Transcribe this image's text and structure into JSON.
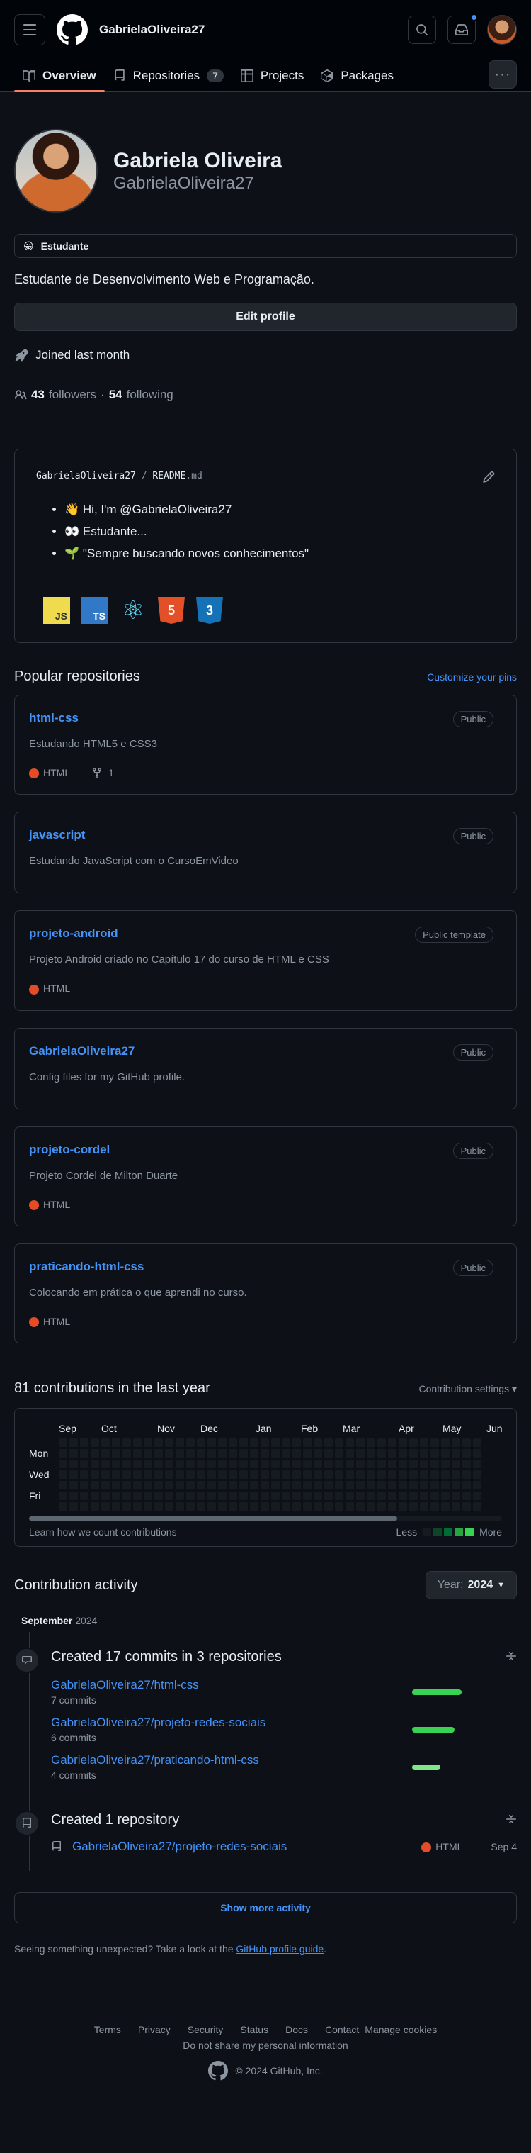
{
  "header": {
    "username": "GabrielaOliveira27"
  },
  "tabs": [
    {
      "label": "Overview"
    },
    {
      "label": "Repositories",
      "count": "7"
    },
    {
      "label": "Projects"
    },
    {
      "label": "Packages"
    }
  ],
  "more_label": "···",
  "profile": {
    "name": "Gabriela Oliveira",
    "login": "GabrielaOliveira27",
    "status_emoji": "😀",
    "status": "Estudante",
    "bio": "Estudante de Desenvolvimento Web e Programação.",
    "edit_label": "Edit profile",
    "joined": "Joined last month",
    "followers": "43",
    "followers_label": "followers",
    "sep": "·",
    "following": "54",
    "following_label": "following"
  },
  "readme": {
    "path_user": "GabrielaOliveira27",
    "path_sep": "/",
    "path_file": "README",
    "path_ext": ".md",
    "items": [
      "👋 Hi, I'm @GabrielaOliveira27",
      "👀 Estudante...",
      "🌱 \"Sempre buscando novos conhecimentos\""
    ],
    "tech": [
      "JS",
      "TS",
      "⚛",
      "5",
      "3"
    ]
  },
  "popular": {
    "title": "Popular repositories",
    "customize": "Customize your pins",
    "repos": [
      {
        "name": "html-css",
        "visibility": "Public",
        "desc": "Estudando HTML5 e CSS3",
        "lang": "HTML",
        "forks": "1"
      },
      {
        "name": "javascript",
        "visibility": "Public",
        "desc": "Estudando JavaScript com o CursoEmVideo",
        "lang": "",
        "forks": ""
      },
      {
        "name": "projeto-android",
        "visibility": "Public template",
        "desc": "Projeto Android criado no Capítulo 17 do curso de HTML e CSS",
        "lang": "HTML",
        "forks": ""
      },
      {
        "name": "GabrielaOliveira27",
        "visibility": "Public",
        "desc": "Config files for my GitHub profile.",
        "lang": "",
        "forks": ""
      },
      {
        "name": "projeto-cordel",
        "visibility": "Public",
        "desc": "Projeto Cordel de Milton Duarte",
        "lang": "HTML",
        "forks": ""
      },
      {
        "name": "praticando-html-css",
        "visibility": "Public",
        "desc": "Colocando em prática o que aprendi no curso.",
        "lang": "HTML",
        "forks": ""
      }
    ]
  },
  "contributions": {
    "title": "81 contributions in the last year",
    "settings": "Contribution settings ▾",
    "months": [
      "Sep",
      "Oct",
      "Nov",
      "Dec",
      "Jan",
      "Feb",
      "Mar",
      "Apr",
      "May",
      "Jun"
    ],
    "days": [
      "",
      "Mon",
      "",
      "Wed",
      "",
      "Fri",
      ""
    ],
    "learn": "Learn how we count contributions",
    "less": "Less",
    "more": "More",
    "legend_colors": [
      "#161b22",
      "#0e4429",
      "#006d32",
      "#26a641",
      "#39d353"
    ]
  },
  "activity": {
    "title": "Contribution activity",
    "year_label": "Year:",
    "year": "2024",
    "month": "September",
    "month_year": "2024",
    "commits_title": "Created 17 commits in 3 repositories",
    "commits": [
      {
        "repo": "GabrielaOliveira27/html-css",
        "count": "7 commits",
        "bar": 0.35,
        "color": "#39d353"
      },
      {
        "repo": "GabrielaOliveira27/projeto-redes-sociais",
        "count": "6 commits",
        "bar": 0.3,
        "color": "#39d353"
      },
      {
        "repo": "GabrielaOliveira27/praticando-html-css",
        "count": "4 commits",
        "bar": 0.2,
        "color": "#7ee787"
      }
    ],
    "created_title": "Created 1 repository",
    "created_repo": "GabrielaOliveira27/projeto-redes-sociais",
    "created_lang": "HTML",
    "created_date": "Sep 4",
    "show_more": "Show more activity",
    "unexpected": "Seeing something unexpected? Take a look at the",
    "guide": "GitHub profile guide",
    "period": "."
  },
  "footer": {
    "links": [
      "Terms",
      "Privacy",
      "Security",
      "Status",
      "Docs",
      "Contact",
      "Manage cookies"
    ],
    "no_share": "Do not share my personal information",
    "copyright": "© 2024 GitHub, Inc."
  }
}
